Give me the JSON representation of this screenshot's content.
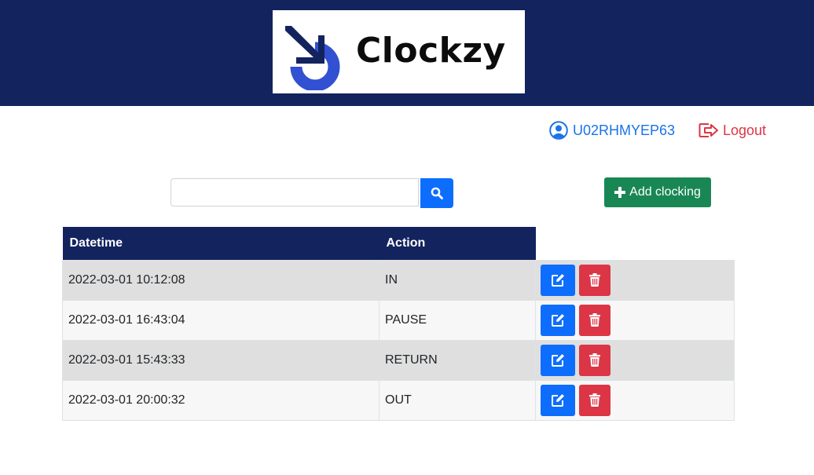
{
  "brand": {
    "name": "Clockzy",
    "logo_icon": "clock-in-arrow-icon",
    "color": "#13235e"
  },
  "user": {
    "id": "U02RHMYEP63",
    "icon": "user-circle-icon"
  },
  "logout": {
    "label": "Logout",
    "icon": "sign-out-icon"
  },
  "search": {
    "value": "",
    "placeholder": "",
    "button_icon": "search-icon"
  },
  "add_button": {
    "label": "Add clocking",
    "icon": "plus-icon"
  },
  "table": {
    "headers": [
      "Datetime",
      "Action",
      ""
    ],
    "rows": [
      {
        "datetime": "2022-03-01 10:12:08",
        "action": "IN"
      },
      {
        "datetime": "2022-03-01 16:43:04",
        "action": "PAUSE"
      },
      {
        "datetime": "2022-03-01 15:43:33",
        "action": "RETURN"
      },
      {
        "datetime": "2022-03-01 20:00:32",
        "action": "OUT"
      }
    ],
    "row_actions": [
      {
        "icon": "edit-icon",
        "color": "#0d6efd"
      },
      {
        "icon": "trash-icon",
        "color": "#dc3545"
      }
    ]
  },
  "colors": {
    "primary": "#0d6efd",
    "success": "#198754",
    "danger": "#dc3545",
    "navy": "#13235e"
  }
}
